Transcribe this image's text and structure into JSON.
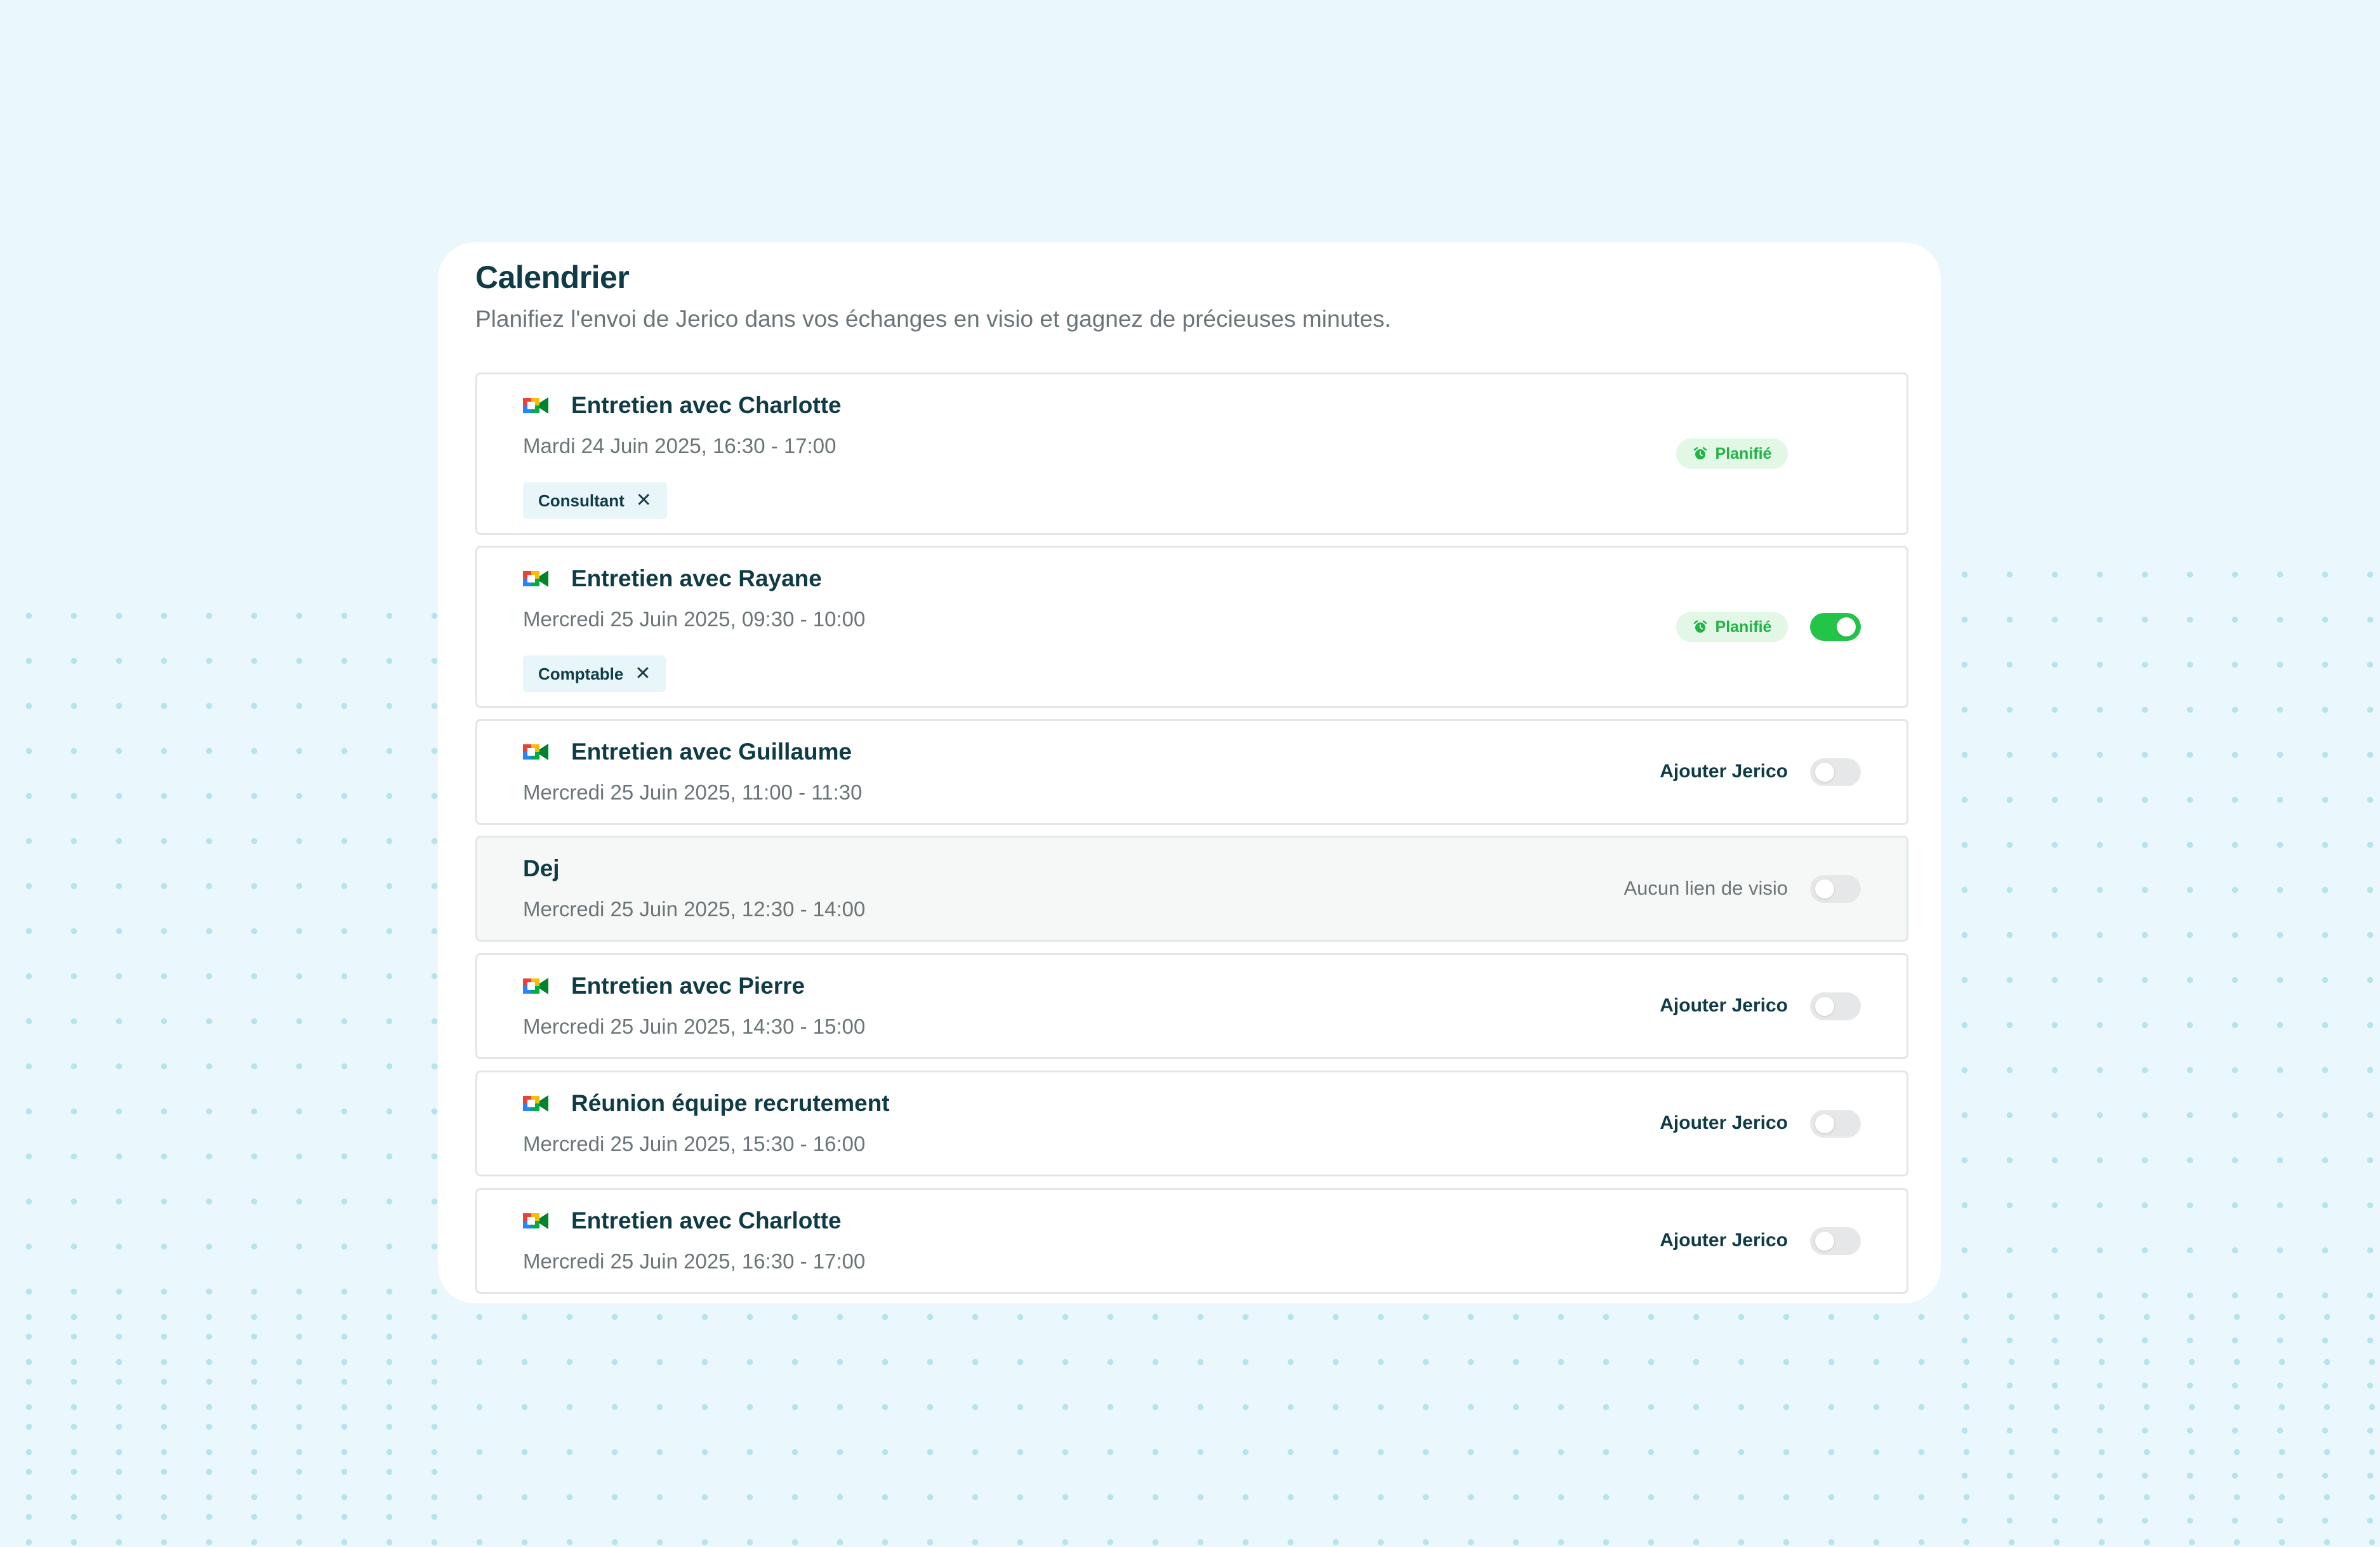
{
  "header": {
    "title": "Calendrier",
    "subtitle": "Planifiez l'envoi de Jerico dans vos échanges en visio et gagnez de précieuses minutes."
  },
  "events": [
    {
      "title": "Entretien avec Charlotte",
      "date": "Mardi 24 Juin 2025, 16:30 - 17:00",
      "tag": "Consultant",
      "status": "Planifié",
      "icon": "google-meet-icon"
    },
    {
      "title": "Entretien avec Rayane",
      "date": "Mercredi 25 Juin 2025, 09:30 - 10:00",
      "tag": "Comptable",
      "status": "Planifié",
      "toggle_on": true,
      "icon": "google-meet-icon"
    },
    {
      "title": "Entretien avec Guillaume",
      "date": "Mercredi 25 Juin 2025, 11:00 - 11:30",
      "action": "Ajouter Jerico",
      "toggle_on": false,
      "icon": "google-meet-icon"
    },
    {
      "title": "Dej",
      "date": "Mercredi 25 Juin 2025, 12:30 - 14:00",
      "action": "Aucun lien de visio",
      "toggle_on": false
    },
    {
      "title": "Entretien avec Pierre",
      "date": "Mercredi 25 Juin 2025, 14:30 - 15:00",
      "action": "Ajouter Jerico",
      "toggle_on": false,
      "icon": "google-meet-icon"
    },
    {
      "title": "Réunion équipe recrutement",
      "date": "Mercredi 25 Juin 2025, 15:30 - 16:00",
      "action": "Ajouter Jerico",
      "toggle_on": false,
      "icon": "google-meet-icon"
    },
    {
      "title": "Entretien avec Charlotte",
      "date": "Mercredi 25 Juin 2025, 16:30 - 17:00",
      "action": "Ajouter Jerico",
      "toggle_on": false,
      "icon": "google-meet-icon"
    }
  ],
  "colors": {
    "background": "#eaf8fd",
    "title": "#0f3b46",
    "accent_green": "#22c548",
    "badge_bg": "#e2f7e6",
    "tag_bg": "#e8f6fa"
  }
}
